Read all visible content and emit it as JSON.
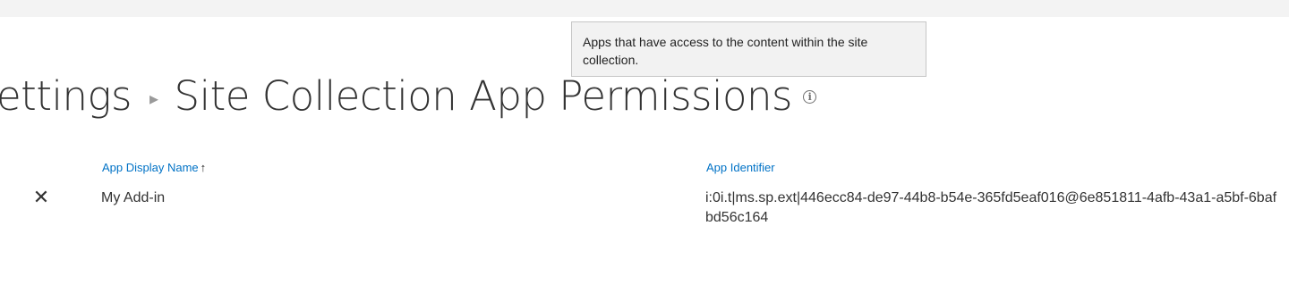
{
  "tooltip": {
    "text": "Apps that have access to the content within the site collection."
  },
  "header": {
    "breadcrumb_parent": "ettings",
    "breadcrumb_separator": "▸",
    "title": "Site Collection App Permissions",
    "info_icon": "info-icon",
    "info_glyph": "i"
  },
  "table": {
    "columns": [
      {
        "label": "App Display Name",
        "sort": "ascending",
        "sort_glyph": "↑"
      },
      {
        "label": "App Identifier"
      }
    ],
    "rows": [
      {
        "delete_icon": "delete-icon",
        "delete_glyph": "✕",
        "display_name": "My Add-in",
        "identifier": "i:0i.t|ms.sp.ext|446ecc84-de97-44b8-b54e-365fd5eaf016@6e851811-4afb-43a1-a5bf-6bafbd56c164"
      }
    ]
  }
}
